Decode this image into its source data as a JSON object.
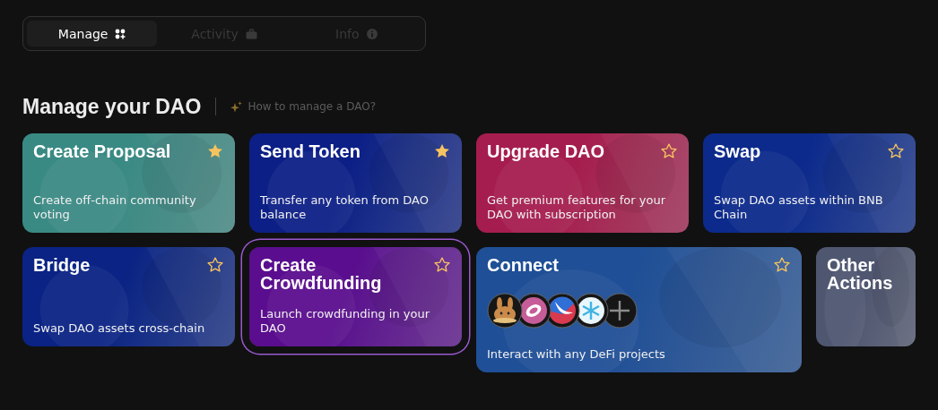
{
  "tabs": [
    {
      "label": "Manage",
      "selected": true
    },
    {
      "label": "Activity",
      "selected": false
    },
    {
      "label": "Info",
      "selected": false
    }
  ],
  "heading": "Manage your DAO",
  "help_link": "How to manage a DAO?",
  "cards": [
    {
      "kind": "action",
      "title": "Create Proposal",
      "description": "Create off-chain community voting",
      "favorite": true,
      "selected": false,
      "color": "#3a8a84"
    },
    {
      "kind": "action",
      "title": "Send Token",
      "description": "Transfer any token from DAO balance",
      "favorite": true,
      "selected": false,
      "color": "#0c1f86"
    },
    {
      "kind": "action",
      "title": "Upgrade DAO",
      "description": "Get premium features for your DAO with subscription",
      "favorite": false,
      "selected": false,
      "color": "#a51d4e"
    },
    {
      "kind": "action",
      "title": "Swap",
      "description": "Swap DAO assets within BNB Chain",
      "favorite": false,
      "selected": false,
      "color": "#0c2a8c"
    },
    {
      "kind": "action",
      "title": "Bridge",
      "description": "Swap DAO assets cross-chain",
      "favorite": false,
      "selected": false,
      "color": "#0a2384"
    },
    {
      "kind": "action",
      "title": "Create Crowdfunding",
      "description": "Launch crowdfunding in your DAO",
      "favorite": false,
      "selected": true,
      "color": "#5a0d8e"
    },
    {
      "kind": "connect",
      "title": "Connect",
      "description": "Interact with any DeFi projects",
      "favorite": false,
      "selected": false,
      "color": "#1f4f96"
    },
    {
      "kind": "more",
      "title": "Other Actions",
      "selected": false,
      "color": "#4f5670"
    }
  ]
}
